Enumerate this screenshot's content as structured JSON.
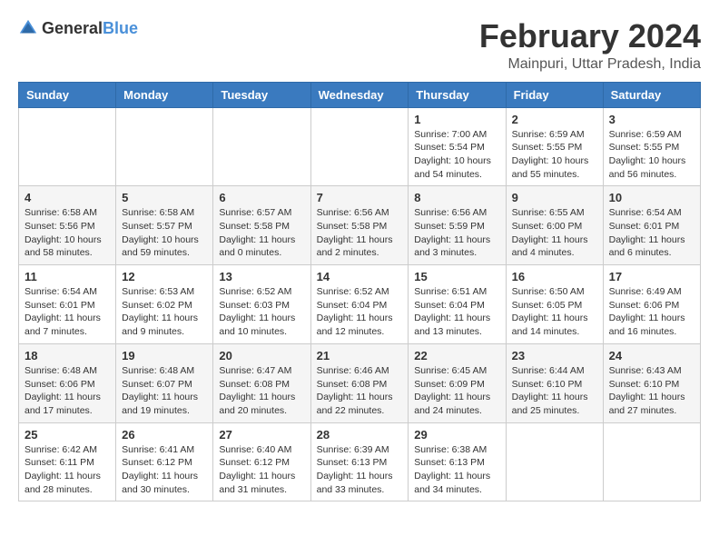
{
  "logo": {
    "text_general": "General",
    "text_blue": "Blue"
  },
  "calendar": {
    "title": "February 2024",
    "subtitle": "Mainpuri, Uttar Pradesh, India"
  },
  "headers": [
    "Sunday",
    "Monday",
    "Tuesday",
    "Wednesday",
    "Thursday",
    "Friday",
    "Saturday"
  ],
  "weeks": [
    [
      {
        "day": "",
        "info": ""
      },
      {
        "day": "",
        "info": ""
      },
      {
        "day": "",
        "info": ""
      },
      {
        "day": "",
        "info": ""
      },
      {
        "day": "1",
        "info": "Sunrise: 7:00 AM\nSunset: 5:54 PM\nDaylight: 10 hours\nand 54 minutes."
      },
      {
        "day": "2",
        "info": "Sunrise: 6:59 AM\nSunset: 5:55 PM\nDaylight: 10 hours\nand 55 minutes."
      },
      {
        "day": "3",
        "info": "Sunrise: 6:59 AM\nSunset: 5:55 PM\nDaylight: 10 hours\nand 56 minutes."
      }
    ],
    [
      {
        "day": "4",
        "info": "Sunrise: 6:58 AM\nSunset: 5:56 PM\nDaylight: 10 hours\nand 58 minutes."
      },
      {
        "day": "5",
        "info": "Sunrise: 6:58 AM\nSunset: 5:57 PM\nDaylight: 10 hours\nand 59 minutes."
      },
      {
        "day": "6",
        "info": "Sunrise: 6:57 AM\nSunset: 5:58 PM\nDaylight: 11 hours\nand 0 minutes."
      },
      {
        "day": "7",
        "info": "Sunrise: 6:56 AM\nSunset: 5:58 PM\nDaylight: 11 hours\nand 2 minutes."
      },
      {
        "day": "8",
        "info": "Sunrise: 6:56 AM\nSunset: 5:59 PM\nDaylight: 11 hours\nand 3 minutes."
      },
      {
        "day": "9",
        "info": "Sunrise: 6:55 AM\nSunset: 6:00 PM\nDaylight: 11 hours\nand 4 minutes."
      },
      {
        "day": "10",
        "info": "Sunrise: 6:54 AM\nSunset: 6:01 PM\nDaylight: 11 hours\nand 6 minutes."
      }
    ],
    [
      {
        "day": "11",
        "info": "Sunrise: 6:54 AM\nSunset: 6:01 PM\nDaylight: 11 hours\nand 7 minutes."
      },
      {
        "day": "12",
        "info": "Sunrise: 6:53 AM\nSunset: 6:02 PM\nDaylight: 11 hours\nand 9 minutes."
      },
      {
        "day": "13",
        "info": "Sunrise: 6:52 AM\nSunset: 6:03 PM\nDaylight: 11 hours\nand 10 minutes."
      },
      {
        "day": "14",
        "info": "Sunrise: 6:52 AM\nSunset: 6:04 PM\nDaylight: 11 hours\nand 12 minutes."
      },
      {
        "day": "15",
        "info": "Sunrise: 6:51 AM\nSunset: 6:04 PM\nDaylight: 11 hours\nand 13 minutes."
      },
      {
        "day": "16",
        "info": "Sunrise: 6:50 AM\nSunset: 6:05 PM\nDaylight: 11 hours\nand 14 minutes."
      },
      {
        "day": "17",
        "info": "Sunrise: 6:49 AM\nSunset: 6:06 PM\nDaylight: 11 hours\nand 16 minutes."
      }
    ],
    [
      {
        "day": "18",
        "info": "Sunrise: 6:48 AM\nSunset: 6:06 PM\nDaylight: 11 hours\nand 17 minutes."
      },
      {
        "day": "19",
        "info": "Sunrise: 6:48 AM\nSunset: 6:07 PM\nDaylight: 11 hours\nand 19 minutes."
      },
      {
        "day": "20",
        "info": "Sunrise: 6:47 AM\nSunset: 6:08 PM\nDaylight: 11 hours\nand 20 minutes."
      },
      {
        "day": "21",
        "info": "Sunrise: 6:46 AM\nSunset: 6:08 PM\nDaylight: 11 hours\nand 22 minutes."
      },
      {
        "day": "22",
        "info": "Sunrise: 6:45 AM\nSunset: 6:09 PM\nDaylight: 11 hours\nand 24 minutes."
      },
      {
        "day": "23",
        "info": "Sunrise: 6:44 AM\nSunset: 6:10 PM\nDaylight: 11 hours\nand 25 minutes."
      },
      {
        "day": "24",
        "info": "Sunrise: 6:43 AM\nSunset: 6:10 PM\nDaylight: 11 hours\nand 27 minutes."
      }
    ],
    [
      {
        "day": "25",
        "info": "Sunrise: 6:42 AM\nSunset: 6:11 PM\nDaylight: 11 hours\nand 28 minutes."
      },
      {
        "day": "26",
        "info": "Sunrise: 6:41 AM\nSunset: 6:12 PM\nDaylight: 11 hours\nand 30 minutes."
      },
      {
        "day": "27",
        "info": "Sunrise: 6:40 AM\nSunset: 6:12 PM\nDaylight: 11 hours\nand 31 minutes."
      },
      {
        "day": "28",
        "info": "Sunrise: 6:39 AM\nSunset: 6:13 PM\nDaylight: 11 hours\nand 33 minutes."
      },
      {
        "day": "29",
        "info": "Sunrise: 6:38 AM\nSunset: 6:13 PM\nDaylight: 11 hours\nand 34 minutes."
      },
      {
        "day": "",
        "info": ""
      },
      {
        "day": "",
        "info": ""
      }
    ]
  ]
}
